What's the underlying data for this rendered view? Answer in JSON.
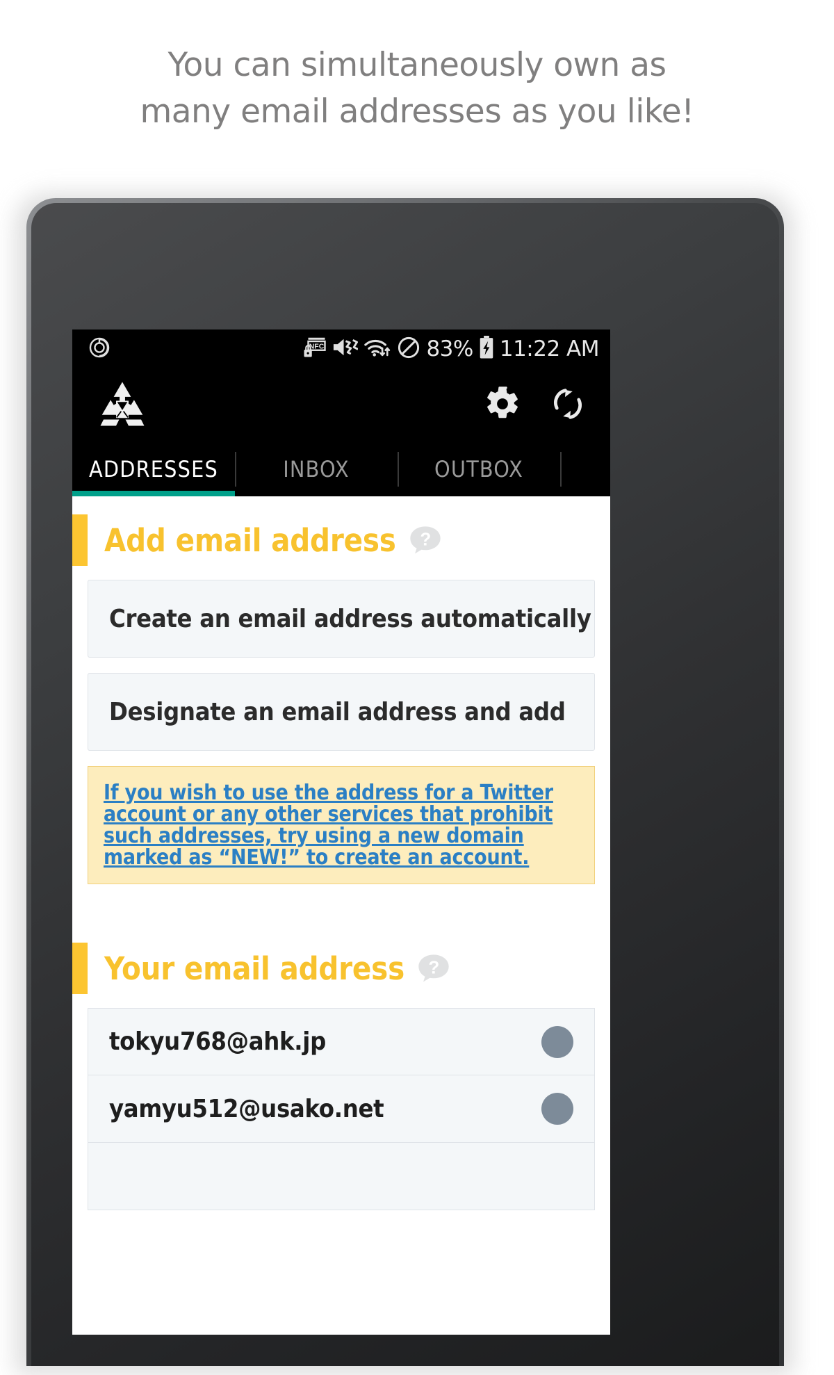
{
  "promo": {
    "line1": "You can simultaneously own as",
    "line2": "many email addresses as you like!"
  },
  "colors": {
    "accent_yellow": "#f8c22e",
    "accent_bar": "#fcc531",
    "tab_active_underline": "#00a08a",
    "link_blue": "#2b7fc4",
    "notice_bg": "#fdedbd",
    "notice_border": "#f1d07a",
    "card_bg": "#f4f7f9",
    "card_border": "#dfe3e8",
    "dot_gray": "#7d8b99",
    "statusbar_bg": "#000000"
  },
  "statusbar": {
    "left_icon": "power-sync-icon",
    "icons": [
      "nfc-lock-icon",
      "volume-mute-vibrate-icon",
      "wifi-transfer-icon",
      "do-not-disturb-icon"
    ],
    "battery_percent": "83%",
    "battery_icon": "battery-charging-icon",
    "time": "11:22 AM"
  },
  "appbar": {
    "logo_icon": "recycle-mail-logo-icon",
    "actions": [
      {
        "icon": "gear-icon",
        "name": "settings-button"
      },
      {
        "icon": "refresh-icon",
        "name": "refresh-button"
      }
    ]
  },
  "tabs": {
    "items": [
      {
        "label": "ADDRESSES",
        "active": true
      },
      {
        "label": "INBOX",
        "active": false
      },
      {
        "label": "OUTBOX",
        "active": false
      }
    ]
  },
  "add_section": {
    "title": "Add email address",
    "help_icon": "help-bubble-icon",
    "buttons": [
      {
        "label": "Create an email address automatically"
      },
      {
        "label": "Designate an email address and add"
      }
    ],
    "notice": {
      "text": "If you wish to use the address for a Twitter account or any other services that prohibit such addresses, try using a new domain marked as “NEW!” to create an account."
    }
  },
  "your_section": {
    "title": "Your email address",
    "help_icon": "help-bubble-icon",
    "addresses": [
      {
        "email": "tokyu768@ahk.jp",
        "status_dot": "gray"
      },
      {
        "email": "yamyu512@usako.net",
        "status_dot": "gray"
      }
    ]
  }
}
